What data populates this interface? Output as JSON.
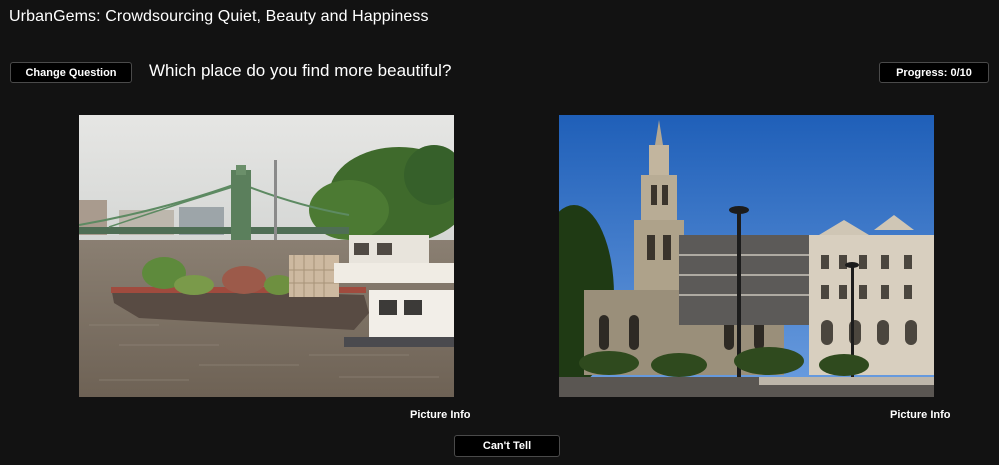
{
  "app": {
    "title": "UrbanGems: Crowdsourcing Quiet, Beauty and Happiness"
  },
  "toolbar": {
    "change_question_label": "Change Question",
    "question_text": "Which place do you find more beautiful?",
    "progress_label": "Progress: 0/10",
    "progress_done": 0,
    "progress_total": 10
  },
  "photos": {
    "left": {
      "info_label": "Picture Info"
    },
    "right": {
      "info_label": "Picture Info"
    }
  },
  "footer": {
    "cant_tell_label": "Can't Tell"
  },
  "colors": {
    "background": "#121212",
    "button_bg": "#000000",
    "text": "#ffffff"
  }
}
